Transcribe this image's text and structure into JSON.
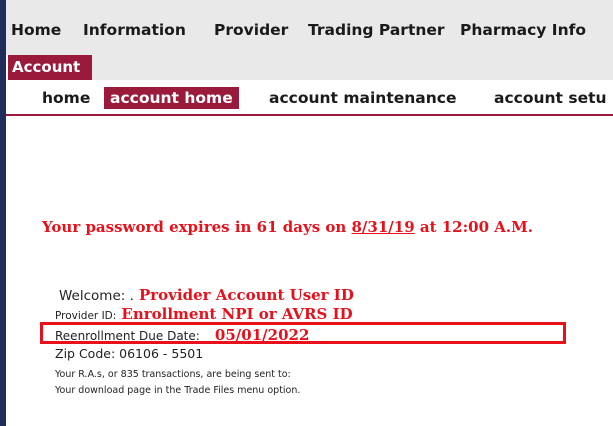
{
  "top_nav": {
    "items": [
      "Home",
      "Information",
      "Provider",
      "Trading Partner",
      "Pharmacy Info"
    ]
  },
  "section_tab": "Account",
  "sub_nav": {
    "items": [
      "home",
      "account home",
      "account maintenance",
      "account setu"
    ],
    "active": "account home"
  },
  "password_message": {
    "prefix": "Your password expires in 61 days on ",
    "date": "8/31/19",
    "suffix": "  at 12:00 A.M."
  },
  "account_info": {
    "welcome_label": "Welcome: .",
    "welcome_value": "Provider Account User ID",
    "provider_id_label": "Provider ID:",
    "provider_id_value": "Enrollment NPI or AVRS ID",
    "reenrollment_label": "Reenrollment Due Date:",
    "reenrollment_value": "05/01/2022",
    "zip_label": "Zip Code:",
    "zip_value": "06106 - 5501",
    "note_line1": "Your R.A.s, or 835 transactions, are being sent to:",
    "note_line2": "Your download page in the Trade Files menu option."
  },
  "colors": {
    "accent": "#9a1a3c",
    "alert_red": "#e8101b",
    "nav_bg": "#e9e9e9"
  }
}
